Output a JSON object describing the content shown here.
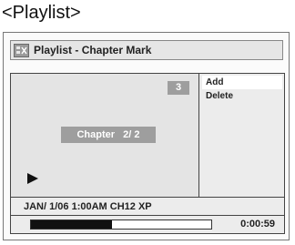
{
  "heading": "<Playlist>",
  "window": {
    "title": "Playlist - Chapter Mark",
    "icon": "disc-edit-icon"
  },
  "preview": {
    "count": "3",
    "chapter_label": "Chapter   2/ 2",
    "play_icon": "play-icon"
  },
  "menu": {
    "items": [
      {
        "label": "Add",
        "selected": true
      },
      {
        "label": "Delete",
        "selected": false
      }
    ]
  },
  "status": {
    "info": "JAN/ 1/06 1:00AM CH12 XP"
  },
  "progress": {
    "fraction": 0.45,
    "time": "0:00:59"
  },
  "colors": {
    "badge": "#9e9e9e",
    "fill": "#111111"
  }
}
